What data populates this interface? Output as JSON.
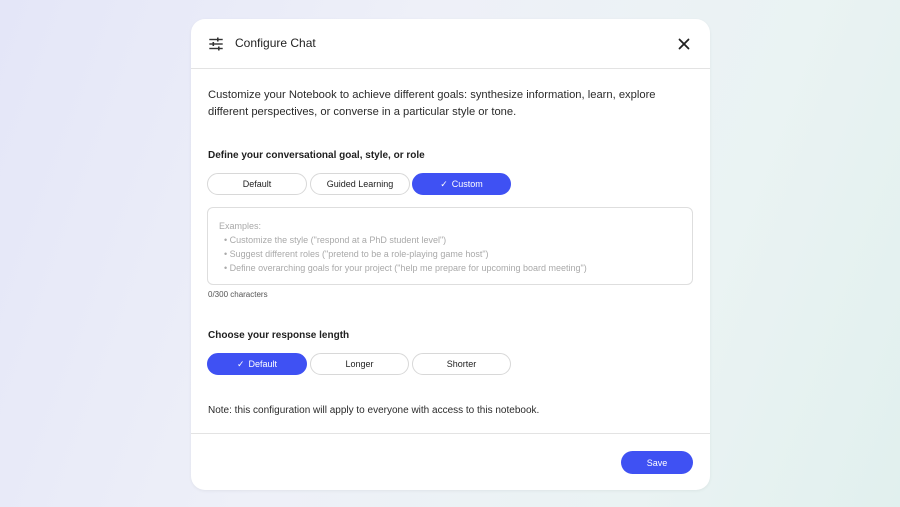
{
  "dialog": {
    "title": "Configure Chat",
    "icon": "tune-icon",
    "close_icon": "close-icon"
  },
  "intro": "Customize your Notebook to achieve different goals: synthesize information, learn, explore different perspectives, or converse in a particular style or tone.",
  "goal_section": {
    "label": "Define your conversational goal, style, or role",
    "options": [
      {
        "label": "Default",
        "selected": false
      },
      {
        "label": "Guided Learning",
        "selected": false
      },
      {
        "label": "Custom",
        "selected": true
      }
    ],
    "textarea": {
      "value": "",
      "placeholder_heading": "Examples:",
      "placeholder_items": [
        "Customize the style (\"respond at a PhD student level\")",
        "Suggest different roles (\"pretend to be a role-playing game host\")",
        "Define overarching goals for your project (\"help me prepare for upcoming board meeting\")"
      ]
    },
    "counter": "0/300 characters"
  },
  "length_section": {
    "label": "Choose your response length",
    "options": [
      {
        "label": "Default",
        "selected": true
      },
      {
        "label": "Longer",
        "selected": false
      },
      {
        "label": "Shorter",
        "selected": false
      }
    ]
  },
  "note": "Note: this configuration will apply to everyone with access to this notebook.",
  "save_label": "Save",
  "colors": {
    "accent": "#3f51f3"
  }
}
